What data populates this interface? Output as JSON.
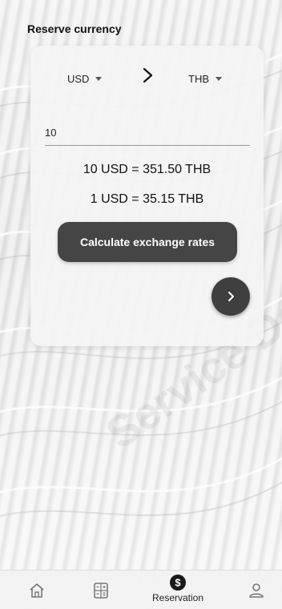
{
  "header": {
    "title": "Reserve currency"
  },
  "converter": {
    "from_currency": "USD",
    "to_currency": "THB",
    "amount_value": "10",
    "result_text": "10 USD = 351.50 THB",
    "unit_rate_text": "1 USD = 35.15 THB",
    "calculate_label": "Calculate exchange rates",
    "icons": {
      "swap": "chevron-right-icon",
      "next": "chevron-right-icon",
      "dropdown": "caret-down-icon"
    }
  },
  "bottom_nav": {
    "items": [
      {
        "name": "home",
        "icon": "home-icon",
        "label": ""
      },
      {
        "name": "calculator",
        "icon": "calculator-icon",
        "label": ""
      },
      {
        "name": "reservation",
        "icon": "dollar-coin-icon",
        "label": "Reservation",
        "active": true
      },
      {
        "name": "profile",
        "icon": "user-icon",
        "label": ""
      }
    ]
  },
  "watermark": "Service Demo"
}
